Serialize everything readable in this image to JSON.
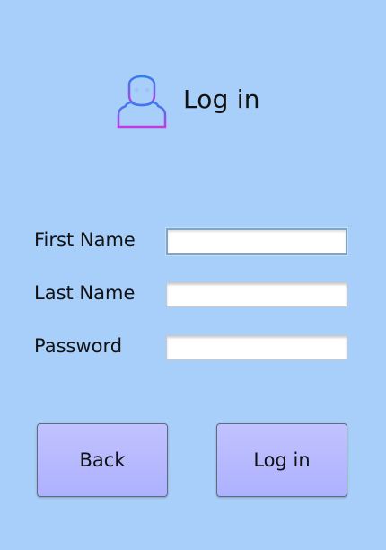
{
  "header": {
    "icon": "user-avatar-icon",
    "title": "Log in"
  },
  "form": {
    "first_name": {
      "label": "First Name",
      "value": "",
      "placeholder": ""
    },
    "last_name": {
      "label": "Last Name",
      "value": "",
      "placeholder": ""
    },
    "password": {
      "label": "Password",
      "value": "",
      "placeholder": ""
    }
  },
  "buttons": {
    "back_label": "Back",
    "login_label": "Log in"
  },
  "colors": {
    "background": "#a8cff9",
    "button_fill": "#b4b6ff",
    "icon_gradient_top": "#2f7ff0",
    "icon_gradient_bottom": "#c43ae0"
  }
}
